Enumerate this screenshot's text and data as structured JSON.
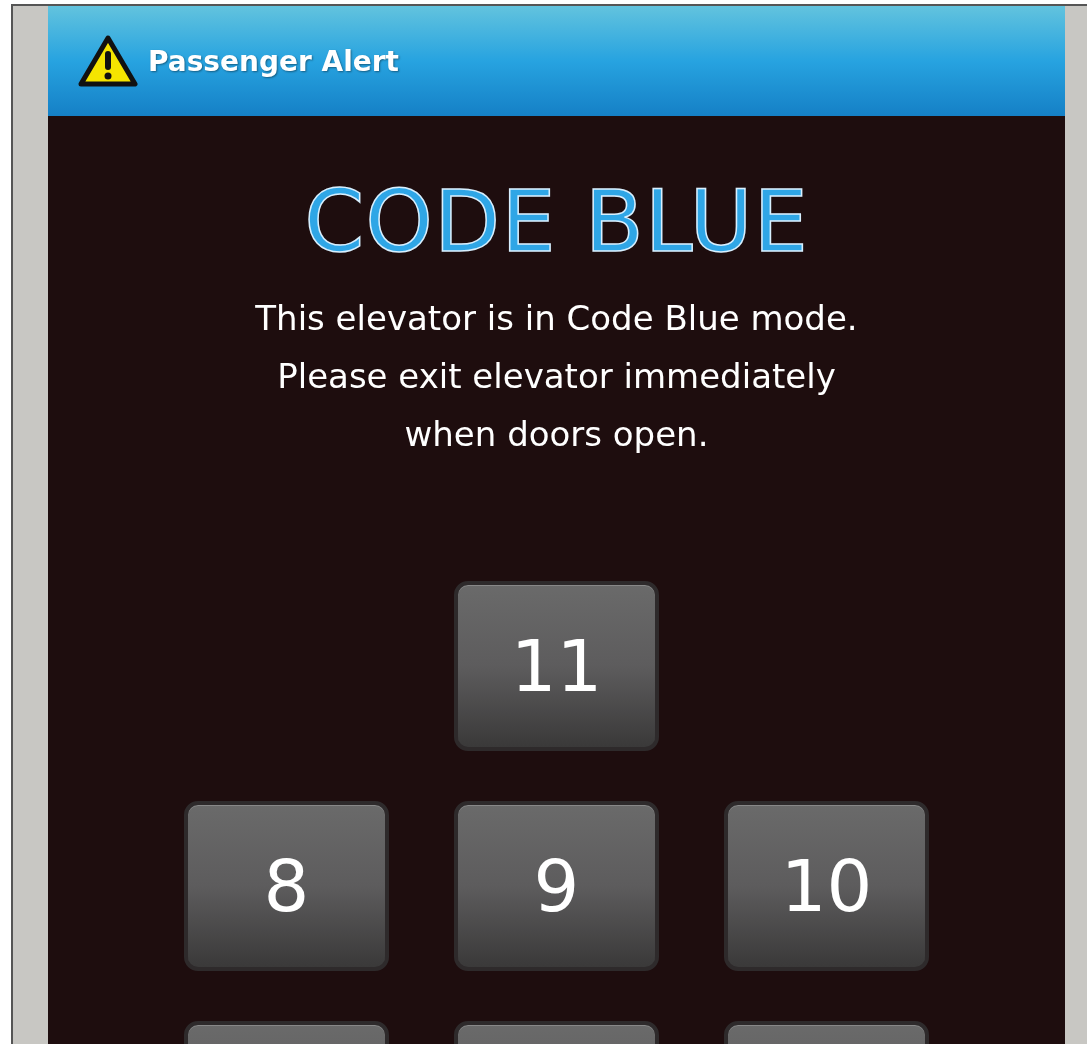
{
  "header": {
    "title": "Passenger Alert"
  },
  "heading": "CODE BLUE",
  "message_lines": [
    "This elevator is in Code Blue mode.",
    "Please exit elevator immediately",
    "when doors open."
  ],
  "floor_rows": [
    [
      null,
      {
        "label": "11"
      },
      null
    ],
    [
      {
        "label": "8"
      },
      {
        "label": "9"
      },
      {
        "label": "10"
      }
    ],
    [
      {},
      {},
      {}
    ]
  ]
}
